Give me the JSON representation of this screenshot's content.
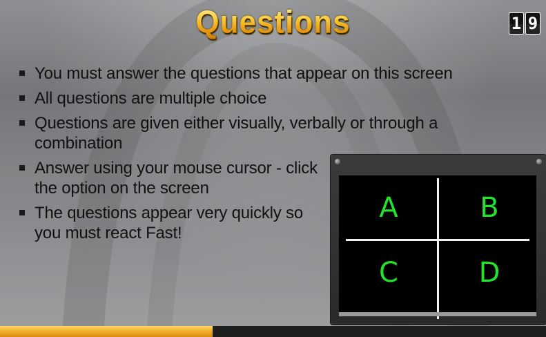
{
  "title": "Questions",
  "counter": {
    "digits": [
      "1",
      "9"
    ]
  },
  "instructions": [
    "You must answer the questions that appear on this screen",
    "All questions are multiple choice",
    "Questions are given either visually, verbally or through a combination",
    "Answer using your mouse cursor - click the option on the screen",
    "The questions appear very quickly so you must react Fast!"
  ],
  "monitor": {
    "options": [
      "A",
      "B",
      "C",
      "D"
    ],
    "option_color": "#22e22a"
  },
  "progress": {
    "value": 0.39,
    "fill_color": "#f2b12b"
  },
  "colors": {
    "title": "#f6b21c",
    "background": "#7e8083",
    "text": "#111111"
  }
}
